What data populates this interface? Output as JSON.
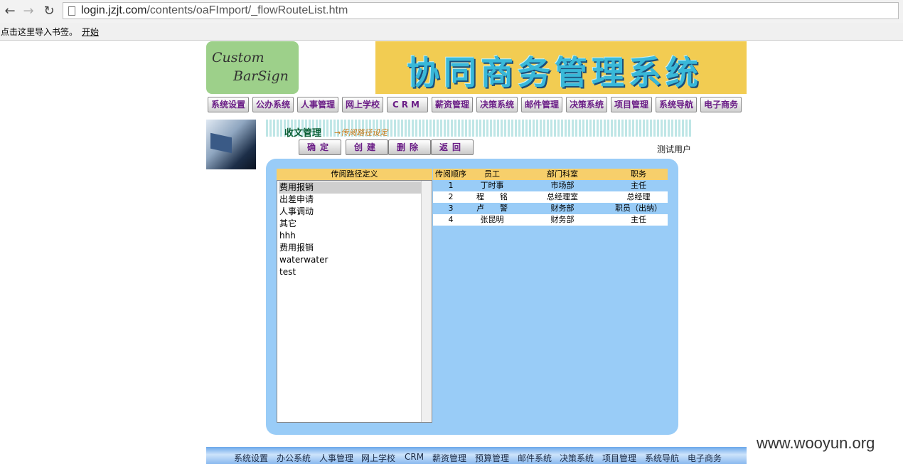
{
  "browser": {
    "url_domain": "login.jzjt.com",
    "url_path": "/contents/oaFImport/_flowRouteList.htm",
    "bookmarks_prompt": "点击这里导入书签。",
    "bookmarks_start": "开始"
  },
  "header": {
    "logo_line1": "Custom",
    "logo_line2": "BarSign",
    "system_title": "协同商务管理系统"
  },
  "menu": [
    "系统设置",
    "公办系统",
    "人事管理",
    "网上学校",
    "CRM",
    "薪资管理",
    "决策系统",
    "邮件管理",
    "决策系统",
    "项目管理",
    "系统导航",
    "电子商务"
  ],
  "section": {
    "title": "收文管理",
    "subtitle": "→传阅路径设定"
  },
  "actions": [
    "确定",
    "创建",
    "删除",
    "返回"
  ],
  "user": "测试用户",
  "route_list": {
    "header": "传阅路径定义",
    "items": [
      "费用报销",
      "出差申请",
      "人事调动",
      "其它",
      "hhh",
      "费用报销",
      "waterwater",
      "test"
    ],
    "selected_index": 0
  },
  "grid": {
    "columns": [
      "传阅顺序",
      "员工",
      "部门科室",
      "职务"
    ],
    "rows": [
      [
        "1",
        "丁时事",
        "市场部",
        "主任"
      ],
      [
        "2",
        "程　　铭",
        "总经理室",
        "总经理"
      ],
      [
        "3",
        "卢　　警",
        "财务部",
        "职员（出纳）"
      ],
      [
        "4",
        "张昆明",
        "财务部",
        "主任"
      ]
    ]
  },
  "footer": [
    "系统设置",
    "办公系统",
    "人事管理",
    "网上学校",
    "CRM",
    "薪资管理",
    "预算管理",
    "邮件系统",
    "决策系统",
    "项目管理",
    "系统导航",
    "电子商务"
  ],
  "watermark": "www.wooyun.org"
}
